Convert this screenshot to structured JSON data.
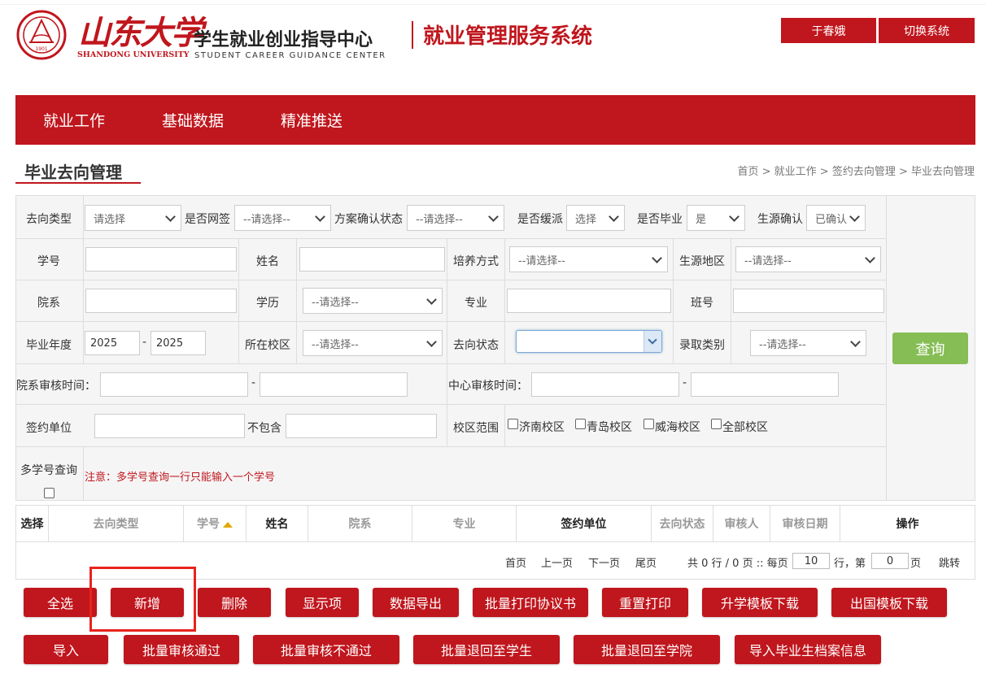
{
  "header": {
    "logo_cn": "山东大学",
    "logo_en": "SHANDONG UNIVERSITY",
    "seal_year": "1901",
    "center_cn": "学生就业创业指导中心",
    "center_en": "STUDENT CAREER GUIDANCE CENTER",
    "system_title": "就业管理服务系统",
    "user_name": "于春娥",
    "switch_label": "切换系统"
  },
  "nav": {
    "items": [
      "就业工作",
      "基础数据",
      "精准推送"
    ]
  },
  "page": {
    "title": "毕业去向管理",
    "breadcrumb": "首页 > 就业工作 > 签约去向管理 > 毕业去向管理"
  },
  "filters": {
    "row1": {
      "type_label": "去向类型",
      "type_value": "请选择",
      "online_label": "是否网签",
      "online_value": "--请选择--",
      "plan_label": "方案确认状态",
      "plan_value": "--请选择--",
      "defer_label": "是否缓派",
      "defer_value": "选择",
      "grad_label": "是否毕业",
      "grad_value": "是",
      "source_label": "生源确认",
      "source_value": "已确认"
    },
    "row2": {
      "sid_label": "学号",
      "name_label": "姓名",
      "train_label": "培养方式",
      "train_value": "--请选择--",
      "region_label": "生源地区",
      "region_value": "--请选择--"
    },
    "row3": {
      "dept_label": "院系",
      "edu_label": "学历",
      "edu_value": "--请选择--",
      "major_label": "专业",
      "class_label": "班号"
    },
    "row4": {
      "year_label": "毕业年度",
      "year_from": "2025",
      "year_sep": "-",
      "year_to": "2025",
      "campus_label": "所在校区",
      "campus_value": "--请选择--",
      "status_label": "去向状态",
      "status_value": "",
      "admit_label": "录取类别",
      "admit_value": "--请选择--"
    },
    "row5": {
      "dept_time_label": "院系审核时间：",
      "sep": "-",
      "center_time_label": "中心审核时间："
    },
    "row6": {
      "unit_label": "签约单位",
      "exclude_label": "不包含",
      "scope_label": "校区范围",
      "campuses": [
        "济南校区",
        "青岛校区",
        "威海校区",
        "全部校区"
      ]
    },
    "row7": {
      "multi_label": "多学号查询",
      "note": "注意：多学号查询一行只能输入一个学号"
    },
    "query_label": "查询"
  },
  "table": {
    "columns": [
      "选择",
      "去向类型",
      "学号",
      "姓名",
      "院系",
      "专业",
      "签约单位",
      "去向状态",
      "审核人",
      "审核日期",
      "操作"
    ]
  },
  "pager": {
    "first": "首页",
    "prev": "上一页",
    "next": "下一页",
    "last": "尾页",
    "total_text": "共 0 行 / 0 页 :: 每页",
    "page_size": "10",
    "rows_sep": "行，第",
    "page_num": "0",
    "page_unit": "页",
    "jump": "跳转"
  },
  "actions": {
    "row1": [
      "全选",
      "新增",
      "删除",
      "显示项",
      "数据导出",
      "批量打印协议书",
      "重置打印",
      "升学模板下载",
      "出国模板下载"
    ],
    "row2": [
      "导入",
      "批量审核通过",
      "批量审核不通过",
      "批量退回至学生",
      "批量退回至学院",
      "导入毕业生档案信息"
    ]
  },
  "colors": {
    "brand_red": "#c0161d",
    "query_green": "#86bd55",
    "highlight_red": "#e8231d",
    "sort_arrow": "#e0a800"
  }
}
